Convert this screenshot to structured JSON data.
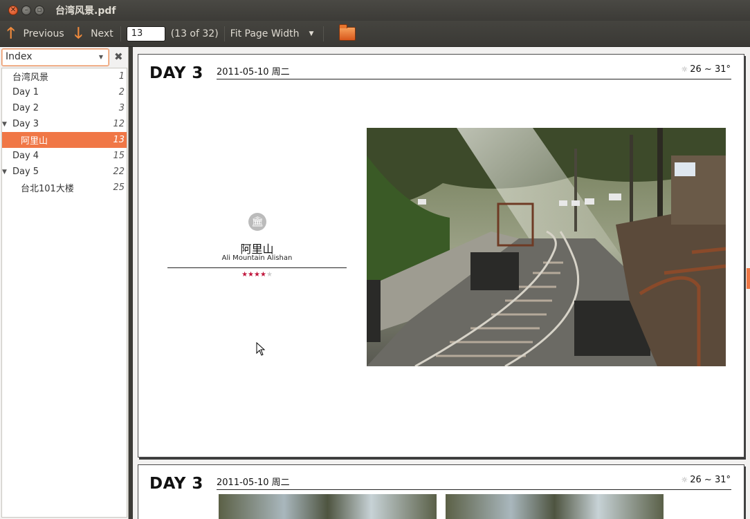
{
  "window": {
    "title": "台湾风景.pdf",
    "controls": [
      "close-icon",
      "minimize-icon",
      "maximize-icon"
    ]
  },
  "toolbar": {
    "previous_label": "Previous",
    "next_label": "Next",
    "page_value": "13",
    "page_count": "(13 of 32)",
    "zoom_label": "Fit Page Width",
    "accent": "#f08a3c"
  },
  "sidebar": {
    "mode": "Index",
    "items": [
      {
        "label": "台湾风景",
        "page": "1",
        "indent": 0,
        "expander": false,
        "selected": false
      },
      {
        "label": "Day 1",
        "page": "2",
        "indent": 0,
        "expander": false,
        "selected": false
      },
      {
        "label": "Day 2",
        "page": "3",
        "indent": 0,
        "expander": false,
        "selected": false
      },
      {
        "label": "Day 3",
        "page": "12",
        "indent": 0,
        "expander": true,
        "selected": false
      },
      {
        "label": "阿里山",
        "page": "13",
        "indent": 1,
        "expander": false,
        "selected": true
      },
      {
        "label": "Day 4",
        "page": "15",
        "indent": 0,
        "expander": false,
        "selected": false
      },
      {
        "label": "Day 5",
        "page": "22",
        "indent": 0,
        "expander": true,
        "selected": false
      },
      {
        "label": "台北101大楼",
        "page": "25",
        "indent": 1,
        "expander": false,
        "selected": false
      }
    ],
    "selection_color": "#f07746"
  },
  "pages": [
    {
      "day": "DAY 3",
      "date": "2011-05-10 周二",
      "weather": "26 ~ 31°",
      "place_name": "阿里山",
      "place_sub": "Ali Mountain Alishan",
      "rating": 4,
      "rating_max": 5
    },
    {
      "day": "DAY 3",
      "date": "2011-05-10 周二",
      "weather": "26 ~ 31°"
    }
  ]
}
